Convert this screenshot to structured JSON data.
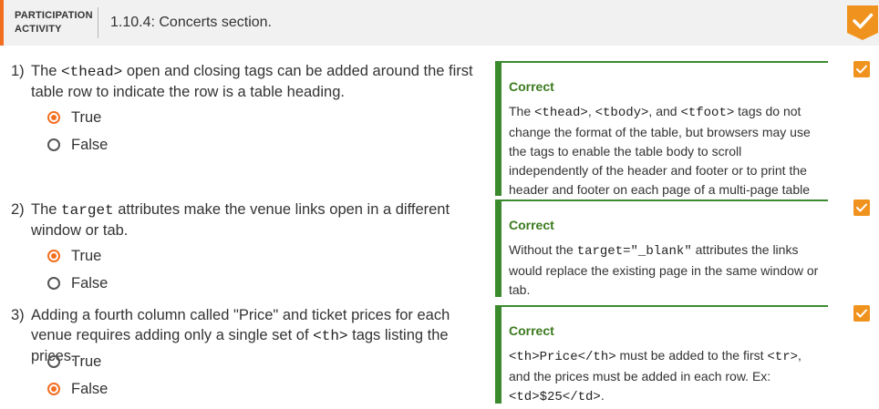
{
  "header": {
    "label_line1": "PARTICIPATION",
    "label_line2": "ACTIVITY",
    "title": "1.10.4: Concerts section."
  },
  "colors": {
    "accent": "#f26f21",
    "correct": "#3b8a2e",
    "check": "#f0931e"
  },
  "questions": [
    {
      "number": "1)",
      "text_a": "The ",
      "code_a": "<thead>",
      "text_b": " open and closing tags can be added around the first table row to indicate the row is a table heading.",
      "options": [
        {
          "label": "True",
          "selected": true
        },
        {
          "label": "False",
          "selected": false
        }
      ],
      "feedback": {
        "status": "Correct",
        "p1": "The ",
        "c1": "<thead>",
        "p2": ", ",
        "c2": "<tbody>",
        "p3": ", and ",
        "c3": "<tfoot>",
        "p4": " tags do not change the format of the table, but browsers may use the tags to enable the table body to scroll independently of the header and footer or to print the header and footer on each page of a multi-page table printout."
      }
    },
    {
      "number": "2)",
      "text_a": "The ",
      "code_a": "target",
      "text_b": " attributes make the venue links open in a different window or tab.",
      "options": [
        {
          "label": "True",
          "selected": true
        },
        {
          "label": "False",
          "selected": false
        }
      ],
      "feedback": {
        "status": "Correct",
        "p1": "Without the ",
        "c1": "target=\"_blank\"",
        "p2": " attributes the links would replace the existing page in the same window or tab."
      }
    },
    {
      "number": "3)",
      "text_a": "Adding a fourth column called \"Price\" and ticket prices for each venue requires adding only a single set of ",
      "code_a": "<th>",
      "text_b": " tags listing the prices.",
      "options": [
        {
          "label": "True",
          "selected": false
        },
        {
          "label": "False",
          "selected": true
        }
      ],
      "feedback": {
        "status": "Correct",
        "c1": "<th>Price</th>",
        "p1": " must be added to the first ",
        "c2": "<tr>",
        "p2": ", and the prices must be added in each row. Ex: ",
        "c3": "<td>$25</td>",
        "p3": "."
      }
    }
  ]
}
